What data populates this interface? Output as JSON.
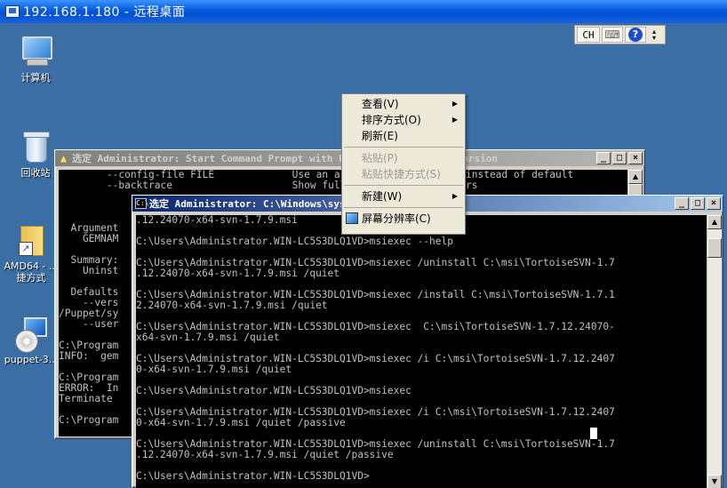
{
  "remote_window": {
    "title": "192.168.1.180 - 远程桌面"
  },
  "desktop_icons": [
    {
      "label": "计算机"
    },
    {
      "label": "回收站"
    },
    {
      "label": "AMD64 - ...",
      "label2": "捷方式"
    },
    {
      "label": "puppet-3..."
    }
  ],
  "language_bar": {
    "lang": "CH",
    "keyboard_icon": "keyboard-icon",
    "help_icon": "help-icon",
    "options_icon": "options-icon"
  },
  "back_console": {
    "title": "选定 Administrator: Start Command Prompt with Puppet - install subversion",
    "lines": [
      "        --config-file FILE             Use an alternate config file instead of default",
      "        --backtrace                    Show full stack trace on errors",
      "",
      "",
      "",
      "  Argument",
      "    GEMNAM",
      "",
      "  Summary:",
      "    Uninst",
      "",
      "  Defaults",
      "    --vers",
      "/Puppet/sy",
      "    --user",
      "",
      "C:\\Program",
      "INFO:  gem",
      "",
      "C:\\Program",
      "ERROR:  In",
      "Terminate ",
      "",
      "C:\\Program"
    ]
  },
  "front_console": {
    "title": "选定 Administrator: C:\\Windows\\system32\\cmd.exe",
    "lines": [
      ".12.24070-x64-svn-1.7.9.msi",
      "",
      "C:\\Users\\Administrator.WIN-LC5S3DLQ1VD>msiexec --help",
      "",
      "C:\\Users\\Administrator.WIN-LC5S3DLQ1VD>msiexec /uninstall C:\\msi\\TortoiseSVN-1.7",
      ".12.24070-x64-svn-1.7.9.msi /quiet",
      "",
      "C:\\Users\\Administrator.WIN-LC5S3DLQ1VD>msiexec /install C:\\msi\\TortoiseSVN-1.7.1",
      "2.24070-x64-svn-1.7.9.msi /quiet",
      "",
      "C:\\Users\\Administrator.WIN-LC5S3DLQ1VD>msiexec  C:\\msi\\TortoiseSVN-1.7.12.24070-",
      "x64-svn-1.7.9.msi /quiet",
      "",
      "C:\\Users\\Administrator.WIN-LC5S3DLQ1VD>msiexec /i C:\\msi\\TortoiseSVN-1.7.12.2407",
      "0-x64-svn-1.7.9.msi /quiet",
      "",
      "C:\\Users\\Administrator.WIN-LC5S3DLQ1VD>msiexec",
      "",
      "C:\\Users\\Administrator.WIN-LC5S3DLQ1VD>msiexec /i C:\\msi\\TortoiseSVN-1.7.12.2407",
      "0-x64-svn-1.7.9.msi /quiet /passive",
      "",
      "C:\\Users\\Administrator.WIN-LC5S3DLQ1VD>msiexec /uninstall C:\\msi\\TortoiseSVN-1.7",
      ".12.24070-x64-svn-1.7.9.msi /quiet /passive",
      "",
      "C:\\Users\\Administrator.WIN-LC5S3DLQ1VD>"
    ]
  },
  "context_menu": {
    "items": [
      {
        "label": "查看(V)",
        "submenu": true,
        "disabled": false
      },
      {
        "label": "排序方式(O)",
        "submenu": true,
        "disabled": false
      },
      {
        "label": "刷新(E)",
        "submenu": false,
        "disabled": false
      },
      {
        "label": "粘贴(P)",
        "submenu": false,
        "disabled": true
      },
      {
        "label": "粘贴快捷方式(S)",
        "submenu": false,
        "disabled": true
      },
      {
        "label": "新建(W)",
        "submenu": true,
        "disabled": false
      },
      {
        "label": "屏幕分辨率(C)",
        "submenu": false,
        "disabled": false
      }
    ]
  },
  "caption_buttons": {
    "minimize": "_",
    "maximize": "□",
    "close": "×"
  }
}
